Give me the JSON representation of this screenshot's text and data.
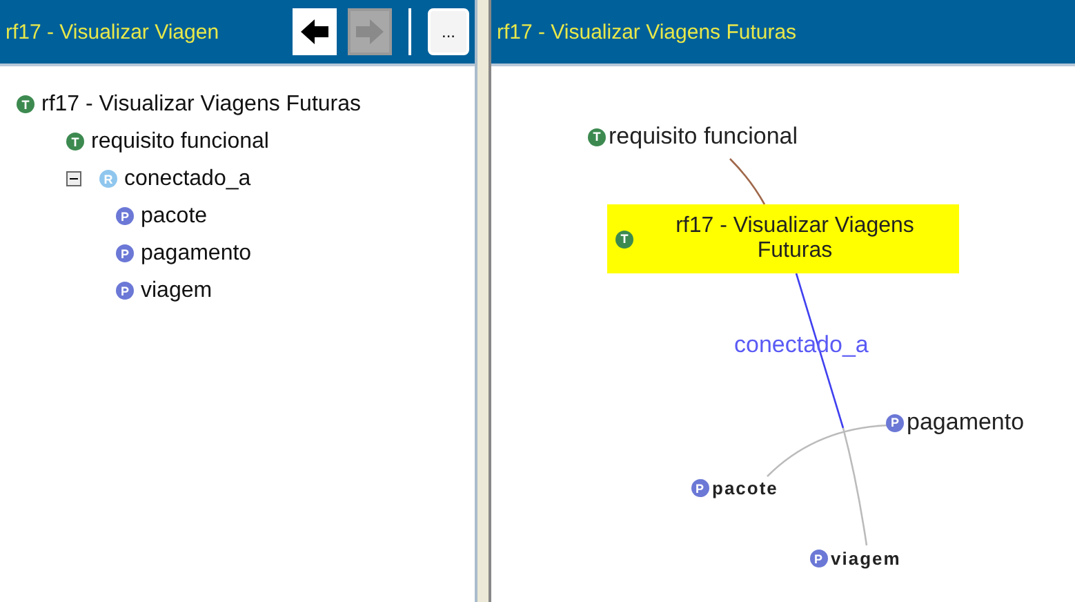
{
  "left_panel": {
    "title": "rf17 - Visualizar Viagen",
    "back_button": {
      "disabled": false
    },
    "forward_button": {
      "disabled": true
    },
    "more_button": {
      "label": "..."
    }
  },
  "tree": [
    {
      "badge": "T",
      "kind": "topic",
      "label": "rf17 - Visualizar Viagens Futuras",
      "children": [
        {
          "badge": "T",
          "kind": "topic",
          "label": "requisito funcional"
        },
        {
          "badge": "R",
          "kind": "role",
          "label": "conectado_a",
          "expanded": true,
          "children": [
            {
              "badge": "P",
              "kind": "player",
              "label": "pacote"
            },
            {
              "badge": "P",
              "kind": "player",
              "label": "pagamento"
            },
            {
              "badge": "P",
              "kind": "player",
              "label": "viagem"
            }
          ]
        }
      ]
    }
  ],
  "right_panel": {
    "title": "rf17 - Visualizar Viagens Futuras"
  },
  "graph": {
    "nodes": [
      {
        "badge": "T",
        "kind": "topic",
        "label": "requisito funcional",
        "selected": false
      },
      {
        "badge": "T",
        "kind": "topic",
        "label": "rf17 - Visualizar Viagens Futuras",
        "selected": true
      },
      {
        "badge": "P",
        "kind": "player",
        "label": "pagamento",
        "selected": false
      },
      {
        "badge": "P",
        "kind": "player",
        "label": "pacote",
        "selected": false
      },
      {
        "badge": "P",
        "kind": "player",
        "label": "viagem",
        "selected": false
      }
    ],
    "edge_label": "conectado_a"
  }
}
